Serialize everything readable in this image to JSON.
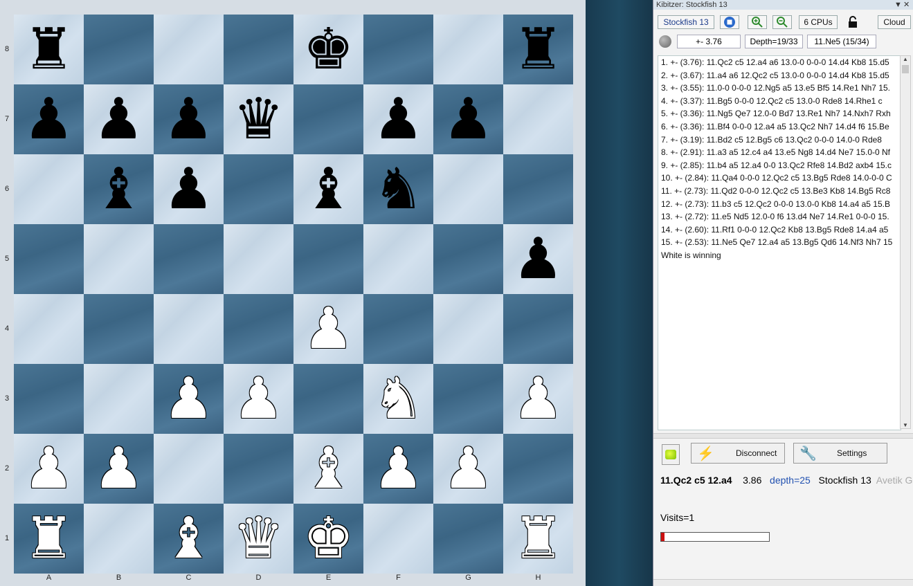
{
  "board": {
    "files": [
      "A",
      "B",
      "C",
      "D",
      "E",
      "F",
      "G",
      "H"
    ],
    "ranks": [
      "8",
      "7",
      "6",
      "5",
      "4",
      "3",
      "2",
      "1"
    ],
    "squares": [
      [
        "black-rook",
        "",
        "",
        "",
        "black-king",
        "",
        "",
        "black-rook"
      ],
      [
        "black-pawn",
        "black-pawn",
        "black-pawn",
        "black-queen",
        "",
        "black-pawn",
        "black-pawn",
        ""
      ],
      [
        "",
        "black-bishop",
        "black-pawn",
        "",
        "black-bishop",
        "black-knight",
        "",
        ""
      ],
      [
        "",
        "",
        "",
        "",
        "",
        "",
        "",
        "black-pawn"
      ],
      [
        "",
        "",
        "",
        "",
        "white-pawn",
        "",
        "",
        ""
      ],
      [
        "",
        "",
        "white-pawn",
        "white-pawn",
        "",
        "white-knight",
        "",
        "white-pawn"
      ],
      [
        "white-pawn",
        "white-pawn",
        "",
        "",
        "white-bishop",
        "white-pawn",
        "white-pawn",
        ""
      ],
      [
        "white-rook",
        "",
        "white-bishop",
        "white-queen",
        "white-king",
        "",
        "",
        "white-rook"
      ]
    ]
  },
  "panel": {
    "title": "Kibitzer: Stockfish 13",
    "toolbar": {
      "engine": "Stockfish 13",
      "cpus": "6 CPUs",
      "cloud": "Cloud"
    },
    "eval": "+- 3.76",
    "depth": "Depth=19/33",
    "current_move": "11.Ne5 (15/34)",
    "lines": [
      "1. +- (3.76): 11.Qc2 c5 12.a4 a6 13.0-0 0-0-0 14.d4 Kb8 15.d5",
      "2. +- (3.67): 11.a4 a6 12.Qc2 c5 13.0-0 0-0-0 14.d4 Kb8 15.d5",
      "3. +- (3.55): 11.0-0 0-0-0 12.Ng5 a5 13.e5 Bf5 14.Re1 Nh7 15.",
      "4. +- (3.37): 11.Bg5 0-0-0 12.Qc2 c5 13.0-0 Rde8 14.Rhe1 c",
      "5. +- (3.36): 11.Ng5 Qe7 12.0-0 Bd7 13.Re1 Nh7 14.Nxh7 Rxh",
      "6. +- (3.36): 11.Bf4 0-0-0 12.a4 a5 13.Qc2 Nh7 14.d4 f6 15.Be",
      "7. +- (3.19): 11.Bd2 c5 12.Bg5 c6 13.Qc2 0-0-0 14.0-0 Rde8",
      "8. +- (2.91): 11.a3 a5 12.c4 a4 13.e5 Ng8 14.d4 Ne7 15.0-0 Nf",
      "9. +- (2.85): 11.b4 a5 12.a4 0-0 13.Qc2 Rfe8 14.Bd2 axb4 15.c",
      "10. +- (2.84): 11.Qa4 0-0-0 12.Qc2 c5 13.Bg5 Rde8 14.0-0-0 C",
      "11. +- (2.73): 11.Qd2 0-0-0 12.Qc2 c5 13.Be3 Kb8 14.Bg5 Rc8",
      "12. +- (2.73): 11.b3 c5 12.Qc2 0-0-0 13.0-0 Kb8 14.a4 a5 15.B",
      "13. +- (2.72): 11.e5 Nd5 12.0-0 f6 13.d4 Ne7 14.Re1 0-0-0 15.",
      "14. +- (2.60): 11.Rf1 0-0-0 12.Qc2 Kb8 13.Bg5 Rde8 14.a4 a5",
      "15. +- (2.53): 11.Ne5 Qe7 12.a4 a5 13.Bg5 Qd6 14.Nf3 Nh7 15",
      "White is winning"
    ],
    "cloud_panel": {
      "disconnect": "Disconnect",
      "settings": "Settings",
      "best_move": "11.Qc2 c5 12.a4",
      "score": "3.86",
      "depth": "depth=25",
      "engine": "Stockfish 13",
      "author": "Avetik Gr",
      "visits": "Visits=1",
      "progress": 0.03
    }
  }
}
